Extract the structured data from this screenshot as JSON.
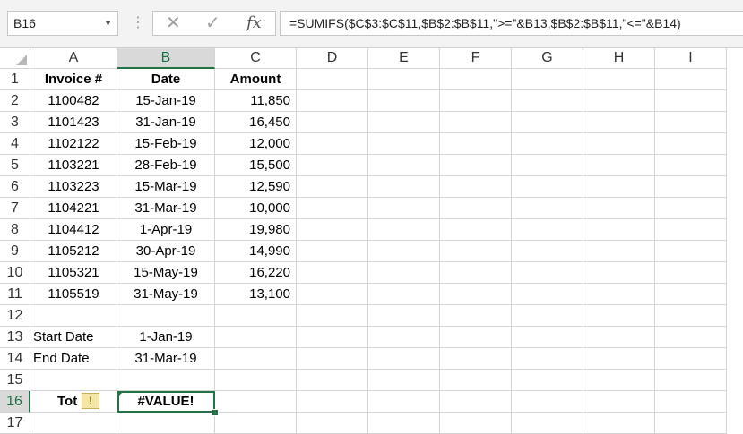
{
  "namebox": {
    "value": "B16"
  },
  "formula_bar": {
    "cancel_icon": "✕",
    "enter_icon": "✓",
    "fx_label": "fx",
    "formula": "=SUMIFS($C$3:$C$11,$B$2:$B$11,\">=\"&B13,$B$2:$B$11,\"<=\"&B14)"
  },
  "columns": [
    "A",
    "B",
    "C",
    "D",
    "E",
    "F",
    "G",
    "H",
    "I"
  ],
  "rows": [
    "1",
    "2",
    "3",
    "4",
    "5",
    "6",
    "7",
    "8",
    "9",
    "10",
    "11",
    "12",
    "13",
    "14",
    "15",
    "16",
    "17"
  ],
  "table": {
    "headers": [
      "Invoice #",
      "Date",
      "Amount"
    ],
    "rows": [
      [
        "1100482",
        "15-Jan-19",
        "11,850"
      ],
      [
        "1101423",
        "31-Jan-19",
        "16,450"
      ],
      [
        "1102122",
        "15-Feb-19",
        "12,000"
      ],
      [
        "1103221",
        "28-Feb-19",
        "15,500"
      ],
      [
        "1103223",
        "15-Mar-19",
        "12,590"
      ],
      [
        "1104221",
        "31-Mar-19",
        "10,000"
      ],
      [
        "1104412",
        "1-Apr-19",
        "19,980"
      ],
      [
        "1105212",
        "30-Apr-19",
        "14,990"
      ],
      [
        "1105321",
        "15-May-19",
        "16,220"
      ],
      [
        "1105519",
        "31-May-19",
        "13,100"
      ]
    ]
  },
  "criteria": {
    "start_label": "Start Date",
    "start_value": "1-Jan-19",
    "end_label": "End Date",
    "end_value": "31-Mar-19"
  },
  "total": {
    "label": "Tot",
    "value": "#VALUE!",
    "warning_icon": "!"
  },
  "active_cell": "B16",
  "accent_color": "#217346"
}
